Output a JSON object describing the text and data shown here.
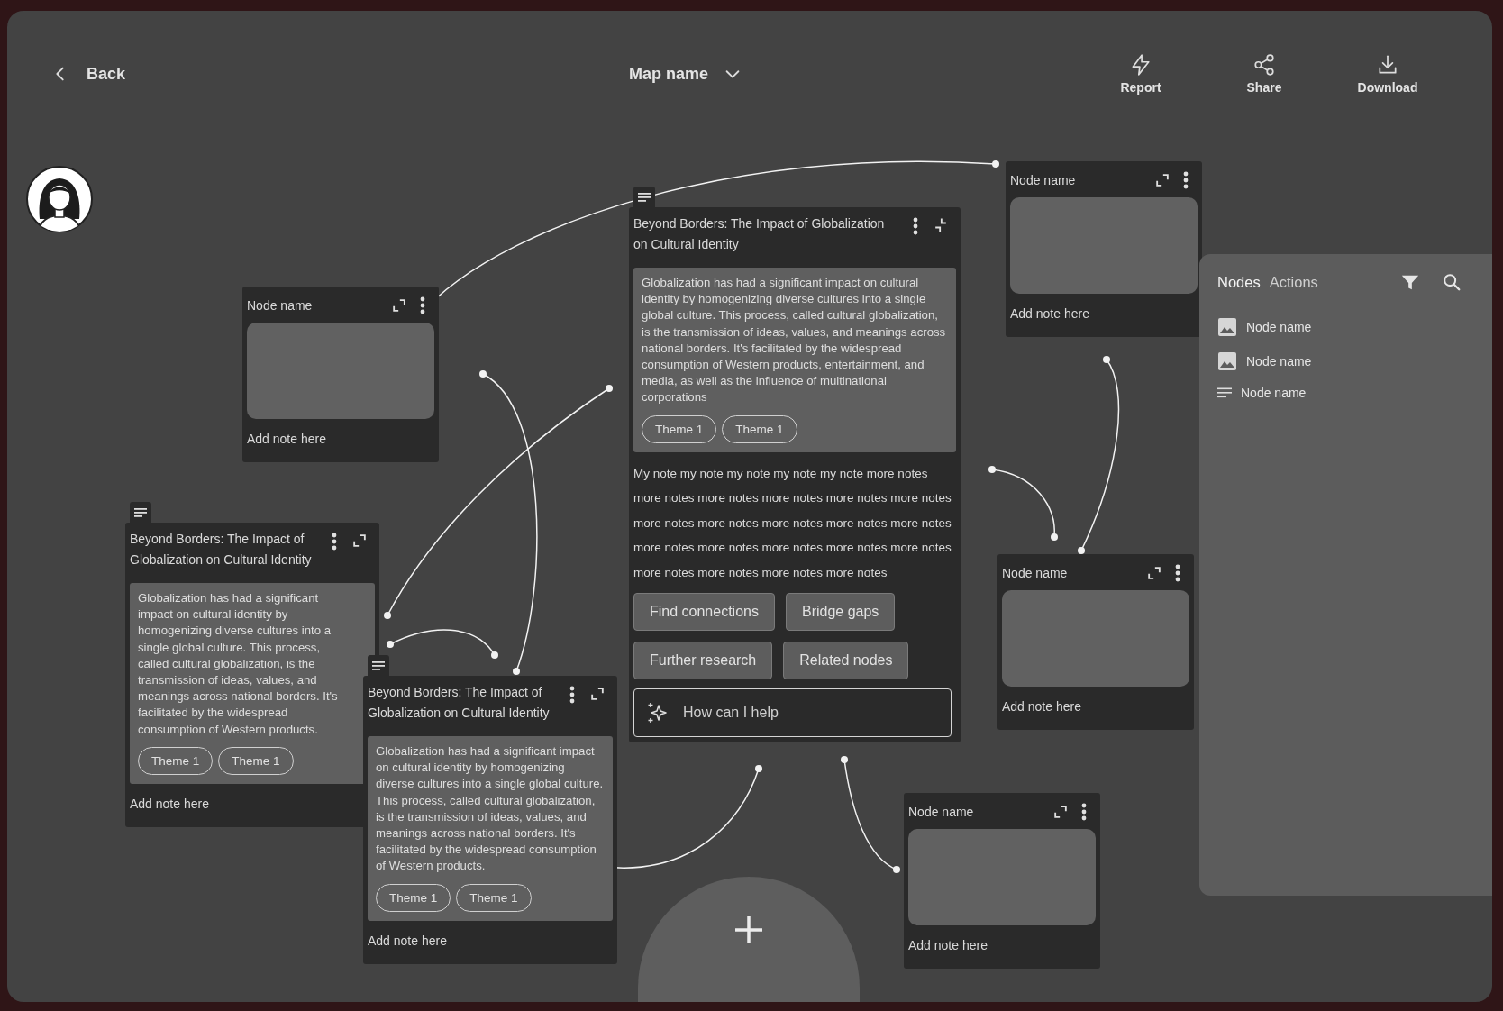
{
  "header": {
    "back_label": "Back",
    "map_name": "Map name",
    "actions": [
      {
        "label": "Report"
      },
      {
        "label": "Share"
      },
      {
        "label": "Download"
      }
    ]
  },
  "nodes": [
    {
      "kind": "media",
      "title": "Node name",
      "note_field": {
        "placeholder": "Add note here"
      }
    },
    {
      "kind": "document",
      "expanded": false,
      "title": "Beyond Borders: The Impact of Globalization on Cultural Identity",
      "summary": "Globalization has had a significant impact on cultural identity by homogenizing diverse cultures into a single global culture. This process, called cultural globalization, is the transmission of ideas, values, and meanings across national borders. It's facilitated by the widespread consumption of Western products.",
      "themes": [
        "Theme 1",
        "Theme 1"
      ],
      "note_field": {
        "placeholder": "Add note here"
      }
    },
    {
      "kind": "document",
      "expanded": false,
      "title": "Beyond Borders: The Impact of Globalization on Cultural Identity",
      "summary": "Globalization has had a significant impact on cultural identity by homogenizing diverse cultures into a single global culture. This process, called cultural globalization, is the transmission of ideas, values, and meanings across national borders. It's facilitated by the widespread consumption of Western products.",
      "themes": [
        "Theme 1",
        "Theme 1"
      ],
      "note_field": {
        "placeholder": "Add note here"
      }
    },
    {
      "kind": "document",
      "expanded": true,
      "title": "Beyond Borders: The Impact of Globalization on Cultural Identity",
      "summary": "Globalization has had a significant impact on cultural identity by homogenizing diverse cultures into a single global culture. This process, called cultural globalization, is the transmission of ideas, values, and meanings across national borders. It's facilitated by the widespread consumption of Western products, entertainment, and media, as well as the influence of multinational corporations",
      "themes": [
        "Theme 1",
        "Theme 1"
      ],
      "note": "My note my note my note my note my note more notes more notes more notes more notes more notes more notes more notes more notes more notes more notes more notes more notes more notes more notes more notes more notes more notes more notes more notes more notes",
      "actions": [
        "Find connections",
        "Bridge gaps",
        "Further research",
        "Related nodes"
      ],
      "help_field": {
        "placeholder": "How can I help"
      }
    },
    {
      "kind": "media",
      "title": "Node name",
      "note_field": {
        "placeholder": "Add note here"
      }
    },
    {
      "kind": "media",
      "title": "Node name",
      "note_field": {
        "placeholder": "Add note here"
      }
    },
    {
      "kind": "media",
      "title": "Node name",
      "note_field": {
        "placeholder": "Add note here"
      }
    }
  ],
  "side_panel": {
    "tabs": [
      {
        "label": "Nodes",
        "selected": true
      },
      {
        "label": "Actions",
        "selected": false
      }
    ],
    "items": [
      {
        "kind": "image",
        "label": "Node name"
      },
      {
        "kind": "image",
        "label": "Node name"
      },
      {
        "kind": "text",
        "label": "Node name"
      }
    ]
  }
}
